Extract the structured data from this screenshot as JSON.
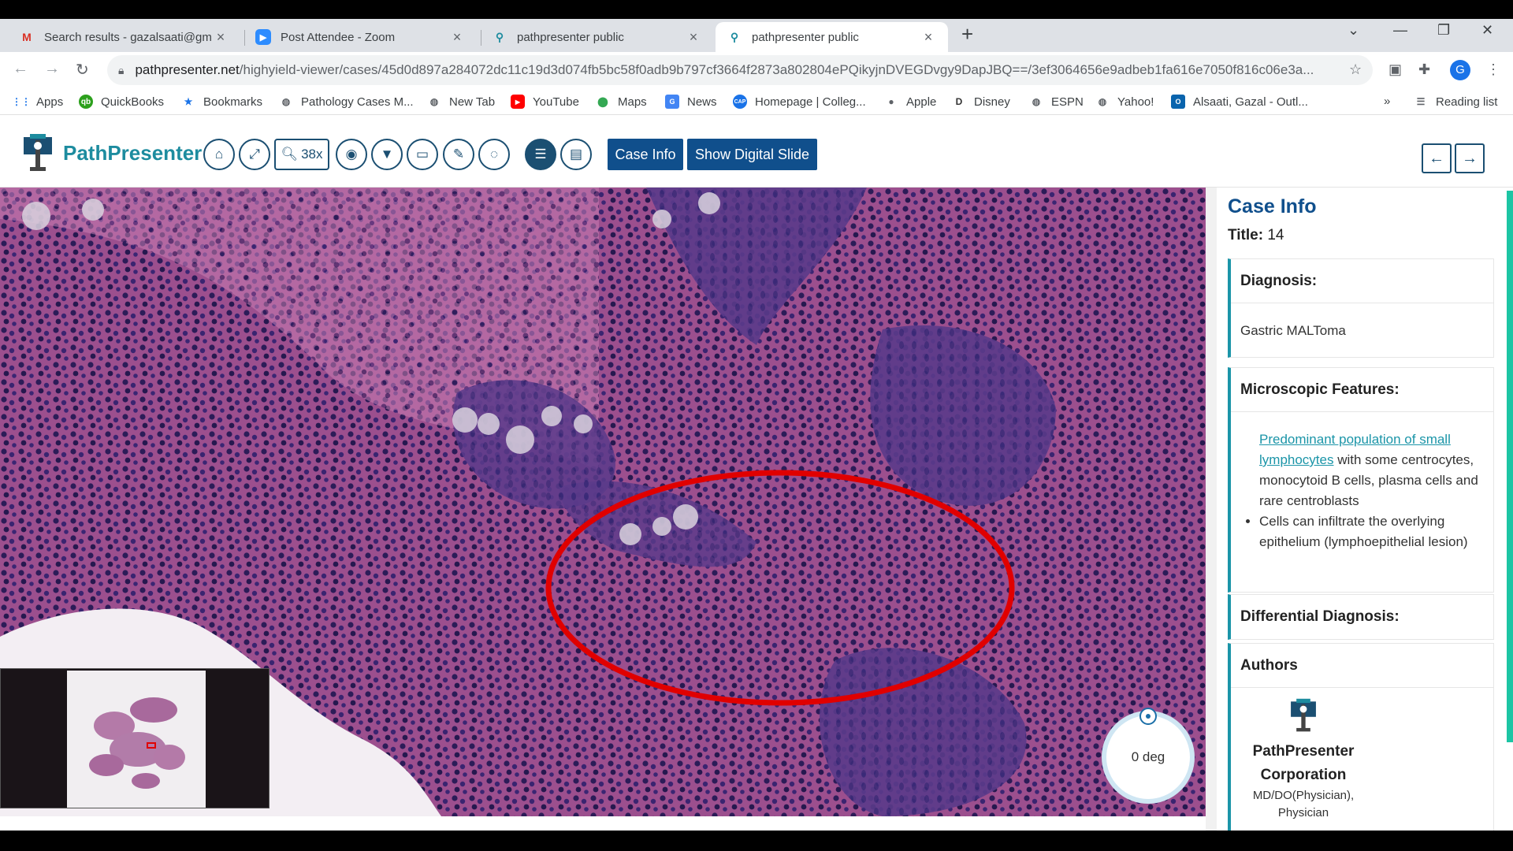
{
  "browser": {
    "tabs": [
      {
        "title": "Search results - gazalsaati@gma",
        "favicon": "gmail-icon",
        "active": false
      },
      {
        "title": "Post Attendee - Zoom",
        "favicon": "zoom-icon",
        "active": false
      },
      {
        "title": "pathpresenter public",
        "favicon": "microscope-icon",
        "active": false
      },
      {
        "title": "pathpresenter public",
        "favicon": "microscope-icon",
        "active": true
      }
    ],
    "url_domain": "pathpresenter.net",
    "url_path": "/highyield-viewer/cases/45d0d897a284072dc11c19d3d074fb5bc58f0adb9b797cf3664f2873a802804ePQikyjnDVEGDvgy9DapJBQ==/3ef3064656e9adbeb1fa616e7050f816c06e3a...",
    "profile_initial": "G",
    "bookmarks": [
      {
        "label": "Apps",
        "icon": "apps-grid-icon"
      },
      {
        "label": "QuickBooks",
        "icon": "quickbooks-icon"
      },
      {
        "label": "Bookmarks",
        "icon": "star-icon"
      },
      {
        "label": "Pathology Cases M...",
        "icon": "globe-icon"
      },
      {
        "label": "New Tab",
        "icon": "globe-icon"
      },
      {
        "label": "YouTube",
        "icon": "youtube-icon"
      },
      {
        "label": "Maps",
        "icon": "maps-pin-icon"
      },
      {
        "label": "News",
        "icon": "news-icon"
      },
      {
        "label": "Homepage | Colleg...",
        "icon": "cap-icon"
      },
      {
        "label": "Apple",
        "icon": "apple-icon"
      },
      {
        "label": "Disney",
        "icon": "disney-icon"
      },
      {
        "label": "ESPN",
        "icon": "globe-icon"
      },
      {
        "label": "Yahoo!",
        "icon": "globe-icon"
      },
      {
        "label": "Alsaati, Gazal - Outl...",
        "icon": "outlook-icon"
      }
    ],
    "bookmarks_overflow": "»",
    "reading_list": "Reading list"
  },
  "app": {
    "brand": "PathPresenter",
    "zoom_label": "38x",
    "case_info_button": "Case Info",
    "show_slide_button": "Show Digital Slide",
    "rotation_label": "0 deg",
    "colors": {
      "primary": "#104f8c",
      "teal": "#1d8c9f",
      "accent_scroll": "#1cc5a4",
      "annotation": "#e00000"
    }
  },
  "panel": {
    "heading": "Case Info",
    "title_label": "Title:",
    "title_value": "14",
    "diagnosis_header": "Diagnosis:",
    "diagnosis_value": "Gastric MALToma",
    "micro_header": "Microscopic Features:",
    "micro_link": "Predominant population of small lymphocytes",
    "micro_first_rest": " with some centrocytes, monocytoid B cells, plasma cells and rare centroblasts",
    "micro_second": "Cells can infiltrate the overlying epithelium (lymphoepithelial lesion)",
    "ddx_header": "Differential Diagnosis:",
    "authors_header": "Authors",
    "author_name": "PathPresenter Corporation",
    "author_role": "MD/DO(Physician), Physician"
  }
}
